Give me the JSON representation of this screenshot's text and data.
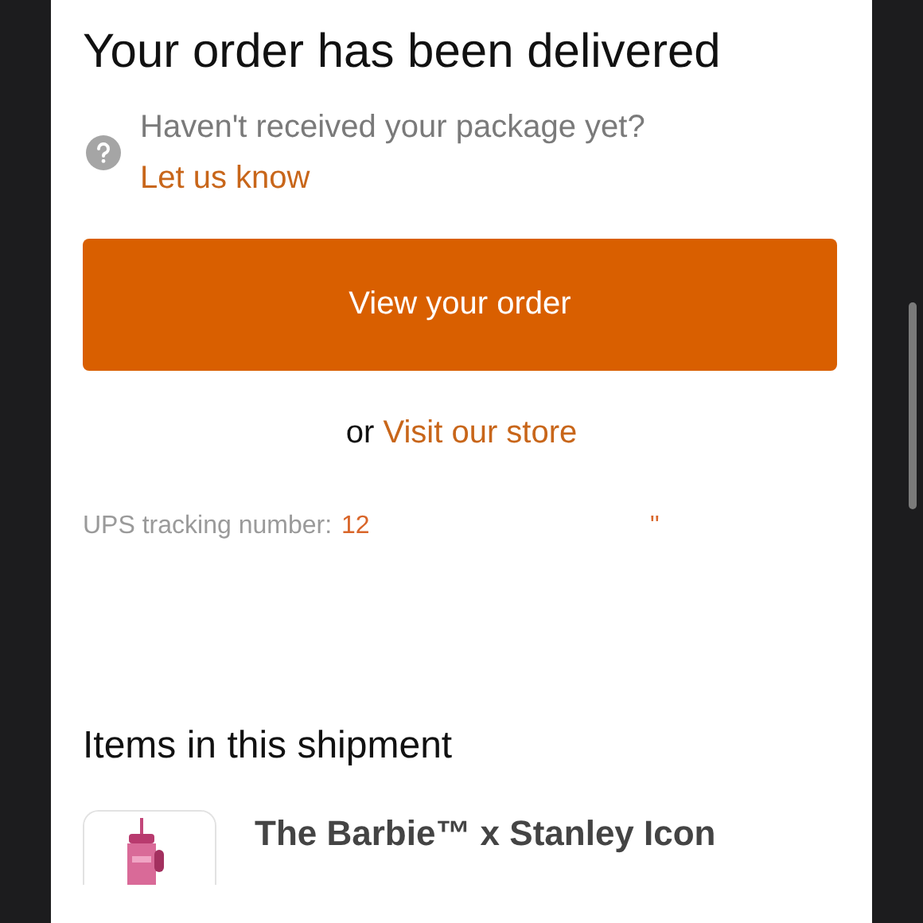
{
  "heading": "Your order has been delivered",
  "help": {
    "text": "Haven't received your package yet?",
    "link": "Let us know"
  },
  "primary_button": "View your order",
  "store_line": {
    "prefix": "or",
    "link": "Visit our store"
  },
  "tracking": {
    "label": "UPS tracking number:",
    "number": "12",
    "suffix": "''"
  },
  "items_heading": "Items in this shipment",
  "items": [
    {
      "title": "The Barbie™ x Stanley Icon",
      "kind": "picture"
    }
  ]
}
